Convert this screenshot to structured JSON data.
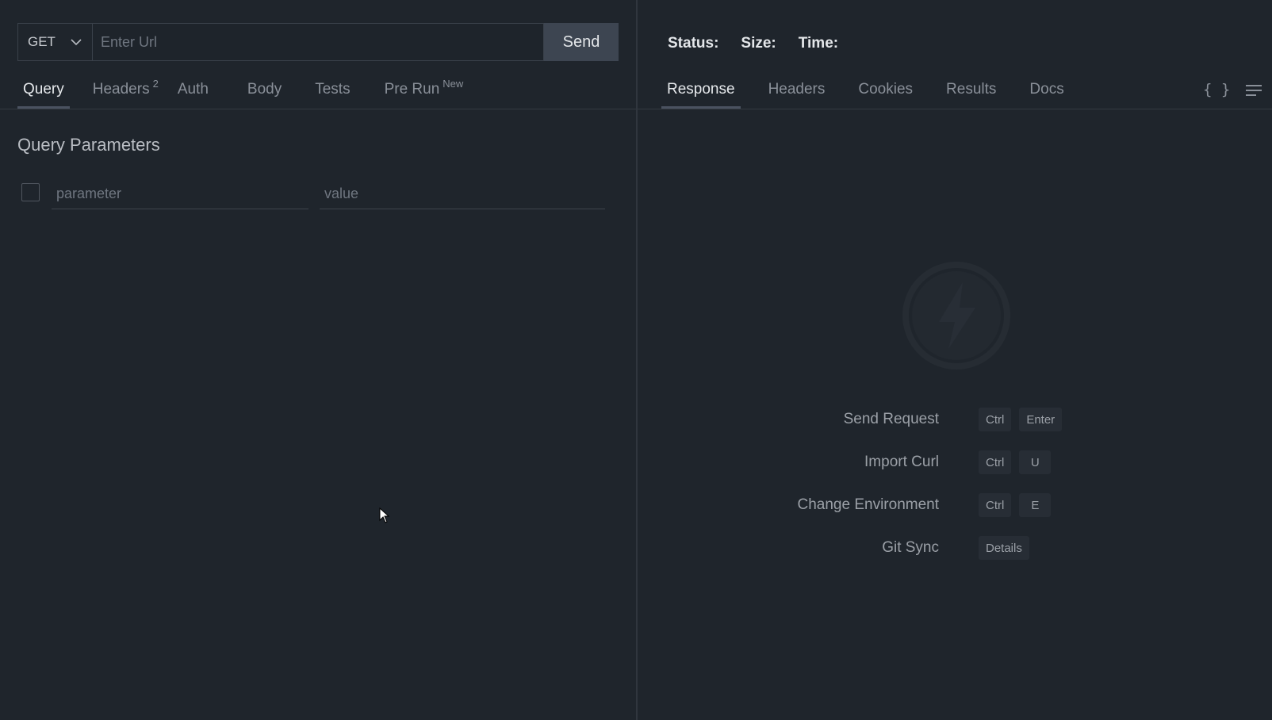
{
  "request": {
    "method": "GET",
    "url_placeholder": "Enter Url",
    "url_value": "",
    "send_label": "Send"
  },
  "request_tabs": [
    {
      "label": "Query",
      "badge": "",
      "active": true
    },
    {
      "label": "Headers",
      "badge": "2",
      "active": false
    },
    {
      "label": "Auth",
      "badge": "",
      "active": false
    },
    {
      "label": "Body",
      "badge": "",
      "active": false
    },
    {
      "label": "Tests",
      "badge": "",
      "active": false
    },
    {
      "label": "Pre Run",
      "badge": "New",
      "active": false
    }
  ],
  "query": {
    "title": "Query Parameters",
    "param_placeholder": "parameter",
    "value_placeholder": "value"
  },
  "response": {
    "status_label": "Status:",
    "size_label": "Size:",
    "time_label": "Time:"
  },
  "response_tabs": [
    {
      "label": "Response",
      "active": true
    },
    {
      "label": "Headers",
      "active": false
    },
    {
      "label": "Cookies",
      "active": false
    },
    {
      "label": "Results",
      "active": false
    },
    {
      "label": "Docs",
      "active": false
    }
  ],
  "icons": {
    "braces": "{ }",
    "menu": "menu-icon",
    "logo": "thunder-logo-icon",
    "dropdown": "chevron-down-icon",
    "cursor": "mouse-cursor"
  },
  "shortcuts": [
    {
      "label": "Send Request",
      "keys": [
        "Ctrl",
        "Enter"
      ]
    },
    {
      "label": "Import Curl",
      "keys": [
        "Ctrl",
        "U"
      ]
    },
    {
      "label": "Change Environment",
      "keys": [
        "Ctrl",
        "E"
      ]
    },
    {
      "label": "Git Sync",
      "keys": [
        "Details"
      ]
    }
  ],
  "colors": {
    "background": "#1f252c",
    "send_button": "#3d4551",
    "divider": "#30363e"
  }
}
